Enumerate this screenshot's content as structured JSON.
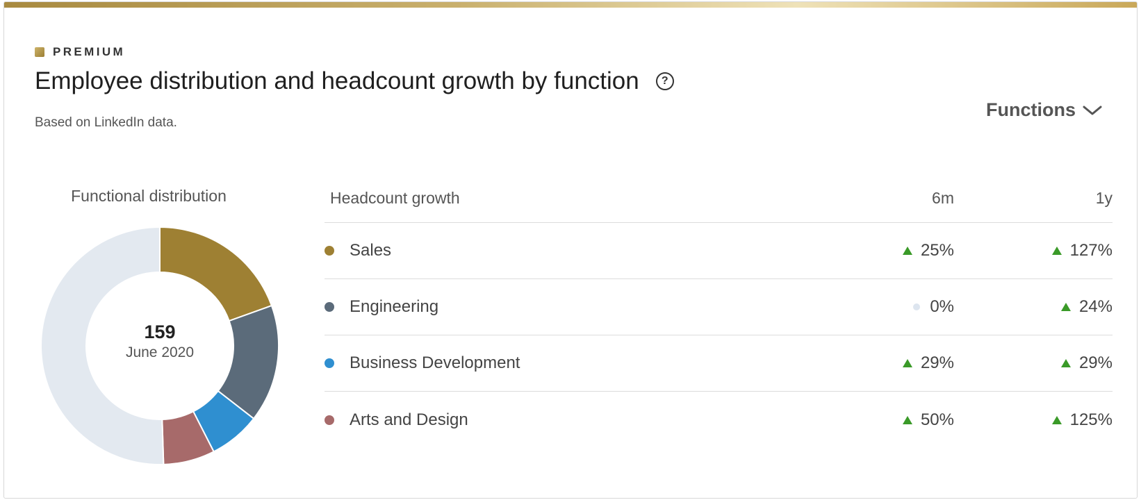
{
  "header": {
    "badge": "PREMIUM",
    "title": "Employee distribution and headcount growth by function",
    "help_icon": "question-circle-icon",
    "subtitle": "Based on LinkedIn data.",
    "dropdown_label": "Functions"
  },
  "distribution": {
    "heading": "Functional distribution",
    "total": "159",
    "date": "June 2020"
  },
  "table": {
    "headers": {
      "name": "Headcount growth",
      "m6": "6m",
      "y1": "1y"
    },
    "rows": [
      {
        "name": "Sales",
        "color": "#9e8033",
        "m6": "25%",
        "m6_trend": "up",
        "y1": "127%",
        "y1_trend": "up"
      },
      {
        "name": "Engineering",
        "color": "#5b6b7a",
        "m6": "0%",
        "m6_trend": "flat",
        "y1": "24%",
        "y1_trend": "up"
      },
      {
        "name": "Business Development",
        "color": "#2f8fd0",
        "m6": "29%",
        "m6_trend": "up",
        "y1": "29%",
        "y1_trend": "up"
      },
      {
        "name": "Arts and Design",
        "color": "#a76a6a",
        "m6": "50%",
        "m6_trend": "up",
        "y1": "125%",
        "y1_trend": "up"
      }
    ]
  },
  "chart_data": {
    "type": "pie",
    "variant": "donut",
    "categories": [
      "Sales",
      "Engineering",
      "Business Development",
      "Arts and Design",
      "Other"
    ],
    "values": [
      0.195,
      0.16,
      0.07,
      0.07,
      0.505
    ],
    "colors": [
      "#9e8033",
      "#5b6b7a",
      "#2f8fd0",
      "#a76a6a",
      "#e3e9f0"
    ],
    "center_value": "159",
    "center_label": "June 2020"
  }
}
